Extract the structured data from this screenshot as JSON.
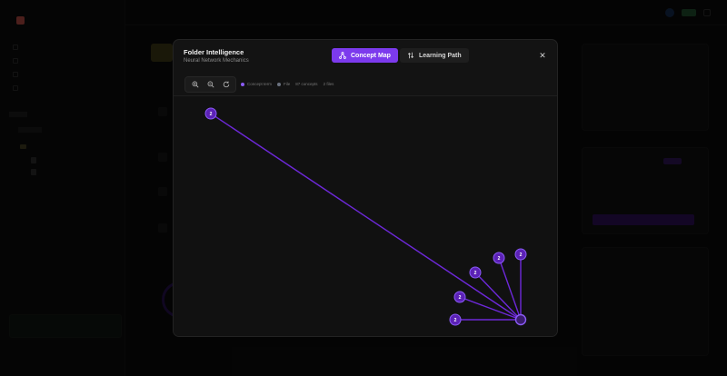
{
  "modal": {
    "title": "Folder Intelligence",
    "subtitle": "Neural Network Mechanics",
    "tabs": [
      {
        "label": "Concept Map",
        "active": true
      },
      {
        "label": "Learning Path",
        "active": false
      }
    ],
    "close_symbol": "✕"
  },
  "toolbar": {
    "legend": [
      {
        "label": "Concept term",
        "color": "#8b5cf6"
      },
      {
        "label": "File",
        "color": "#6b7280"
      }
    ],
    "concepts_count": "87 concepts",
    "files_count": "2 files"
  },
  "graph": {
    "hub": {
      "label": ""
    },
    "nodes": [
      {
        "label": "2"
      },
      {
        "label": "2"
      },
      {
        "label": "2"
      },
      {
        "label": "2"
      },
      {
        "label": "2"
      },
      {
        "label": "2"
      }
    ]
  },
  "colors": {
    "accent": "#7c3aed",
    "edge": "#6d28d9",
    "node_fill": "#5b21b6",
    "node_stroke": "#8b5cf6"
  },
  "icons": [
    "concept-map-icon",
    "learning-path-icon",
    "close-icon",
    "zoom-in-icon",
    "zoom-out-icon",
    "reset-icon"
  ]
}
